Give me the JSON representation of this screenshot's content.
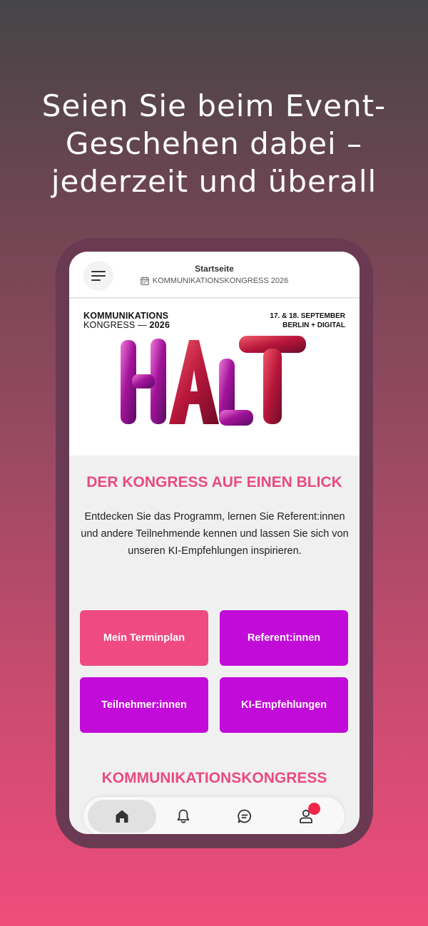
{
  "promo": {
    "headline": "Seien Sie beim Event-Geschehen dabei – jederzeit und überall"
  },
  "header": {
    "title": "Startseite",
    "event_name": "KOMMUNIKATIONSKONGRESS 2026"
  },
  "banner": {
    "line1": "KOMMUNIKATIONS",
    "line2_prefix": "KONGRESS — ",
    "line2_year": "2026",
    "date": "17. & 18. SEPTEMBER",
    "location": "BERLIN + DIGITAL"
  },
  "overview": {
    "title": "DER KONGRESS AUF EINEN BLICK",
    "text": "Entdecken Sie das Programm, lernen Sie Referent:innen und andere Teilnehmende kennen und lassen Sie sich von unseren KI-Empfehlungen inspirieren."
  },
  "tiles": {
    "schedule": "Mein Terminplan",
    "speakers": "Referent:innen",
    "attendees": "Teilnehmer:innen",
    "ai": "KI-Empfehlungen"
  },
  "section2": {
    "title": "KOMMUNIKATIONSKONGRESS"
  },
  "tabbar": {
    "icons": [
      "home-icon",
      "bell-icon",
      "chat-icon",
      "user-icon"
    ],
    "active": "home"
  },
  "colors": {
    "accent_pink": "#ef4a81",
    "accent_purple": "#c20bd9",
    "heading_pink": "#e94a80",
    "notification": "#f2264a"
  }
}
